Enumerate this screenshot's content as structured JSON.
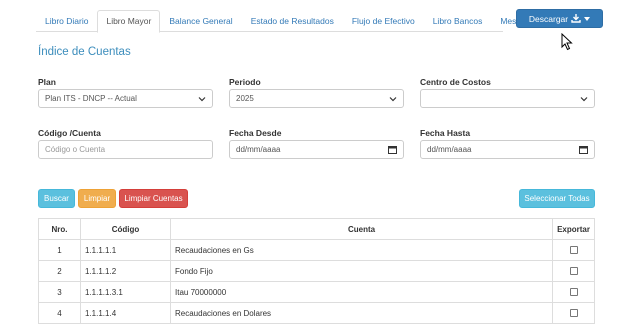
{
  "tabs": [
    {
      "label": "Libro Diario",
      "active": false
    },
    {
      "label": "Libro Mayor",
      "active": true
    },
    {
      "label": "Balance General",
      "active": false
    },
    {
      "label": "Estado de Resultados",
      "active": false
    },
    {
      "label": "Flujo de Efectivo",
      "active": false
    },
    {
      "label": "Libro Bancos",
      "active": false
    },
    {
      "label": "Meses",
      "active": false
    }
  ],
  "download_button": {
    "label": "Descargar",
    "icon": "download-icon"
  },
  "page_title": "Índice de Cuentas",
  "filters": {
    "plan": {
      "label": "Plan",
      "value": "Plan ITS - DNCP -- Actual"
    },
    "periodo": {
      "label": "Periodo",
      "value": "2025"
    },
    "centro_costos": {
      "label": "Centro de Costos",
      "value": ""
    },
    "codigo_cuenta": {
      "label": "Código /Cuenta",
      "placeholder": "Código o Cuenta"
    },
    "fecha_desde": {
      "label": "Fecha Desde",
      "placeholder": "dd/mm/aaaa"
    },
    "fecha_hasta": {
      "label": "Fecha Hasta",
      "placeholder": "dd/mm/aaaa"
    }
  },
  "buttons": {
    "buscar": "Buscar",
    "limpiar": "Limpiar",
    "limpiar_cuentas": "Limpiar Cuentas",
    "seleccionar_todas": "Seleccionar Todas"
  },
  "colors": {
    "primary": "#337ab7",
    "info": "#5bc0de",
    "warning": "#f0ad4e",
    "danger": "#d9534f",
    "title": "#3c8dbc"
  },
  "table": {
    "headers": [
      "Nro.",
      "Código",
      "Cuenta",
      "Exportar"
    ],
    "rows": [
      {
        "nro": "1",
        "codigo": "1.1.1.1.1",
        "cuenta": "Recaudaciones en Gs",
        "exportar": false
      },
      {
        "nro": "2",
        "codigo": "1.1.1.1.2",
        "cuenta": "Fondo Fijo",
        "exportar": false
      },
      {
        "nro": "3",
        "codigo": "1.1.1.1.3.1",
        "cuenta": "Itau 70000000",
        "exportar": false
      },
      {
        "nro": "4",
        "codigo": "1.1.1.1.4",
        "cuenta": "Recaudaciones en Dolares",
        "exportar": false
      }
    ]
  }
}
